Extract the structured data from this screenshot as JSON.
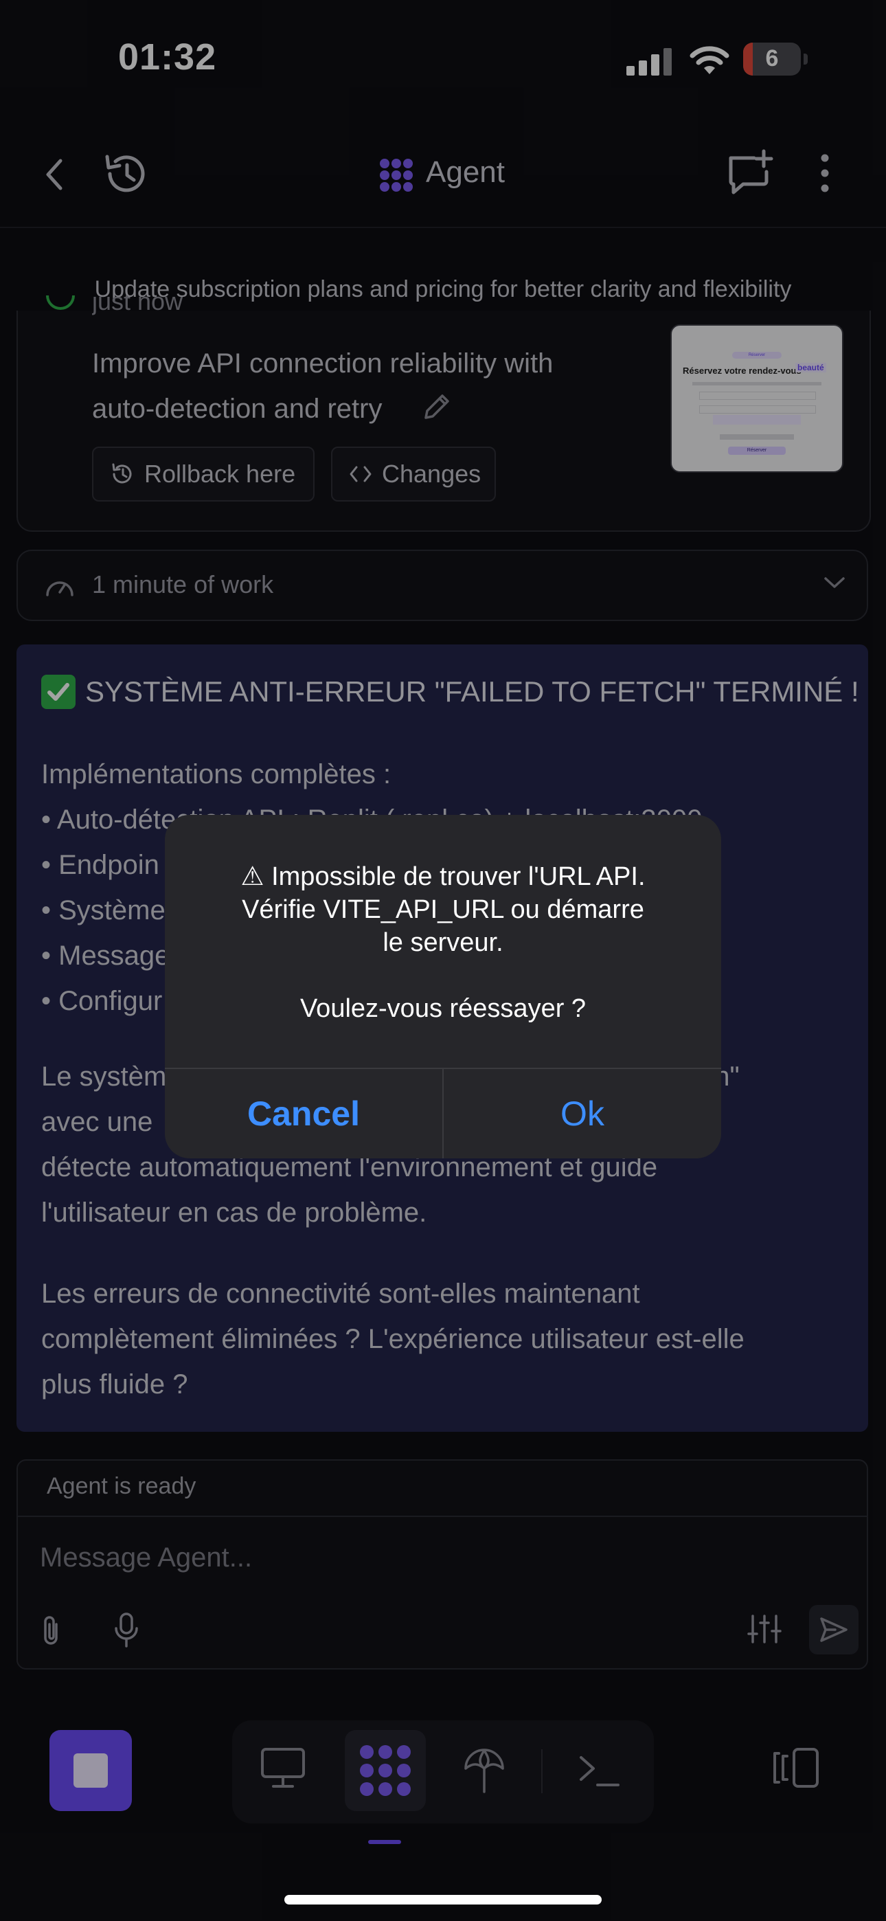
{
  "status_bar": {
    "time": "01:32",
    "battery": "6"
  },
  "header": {
    "title": "Agent"
  },
  "banner": {
    "text": "Update subscription plans and pricing for better clarity and flexibility"
  },
  "checkpoint": {
    "time": "just now",
    "commit_message_lines": [
      "Improve API connection reliability with",
      "auto-detection and retry"
    ],
    "rollback_label": "Rollback here",
    "changes_label": "Changes",
    "thumbnail": {
      "badge": "Réserver",
      "title": "Réservez votre rendez-vous",
      "highlight": "beauté",
      "cta": "Réserver"
    }
  },
  "work_summary": {
    "label": "1 minute of work"
  },
  "message": {
    "headline": "SYSTÈME ANTI-ERREUR \"FAILED TO FETCH\" TERMINÉ !",
    "intro": "Implémentations complètes :",
    "list": [
      "• Auto-détection API : Replit (.repl.co) + localhost:3000",
      "• Endpoin",
      "• Système",
      "• Message                                                          ques)",
      "• Configur"
    ],
    "para1_lines": [
      "Le systèm                                                              to fetch\"",
      "avec une                                                              ion",
      "détecte automatiquement l'environnement et guide",
      "l'utilisateur en cas de problème."
    ],
    "para2_lines": [
      "Les erreurs de connectivité sont-elles maintenant",
      "complètement éliminées ? L'expérience utilisateur est-elle",
      "plus fluide ?"
    ]
  },
  "input": {
    "status": "Agent is ready",
    "placeholder": "Message Agent..."
  },
  "alert": {
    "message_lines": [
      "⚠ Impossible de trouver l'URL API.",
      "Vérifie VITE_API_URL ou démarre",
      "le serveur.",
      "",
      "Voulez-vous réessayer ?"
    ],
    "cancel_label": "Cancel",
    "ok_label": "Ok"
  },
  "colors": {
    "accent": "#6b4cf6",
    "alert_button": "#3d8eff",
    "message_bg": "#23244a"
  }
}
